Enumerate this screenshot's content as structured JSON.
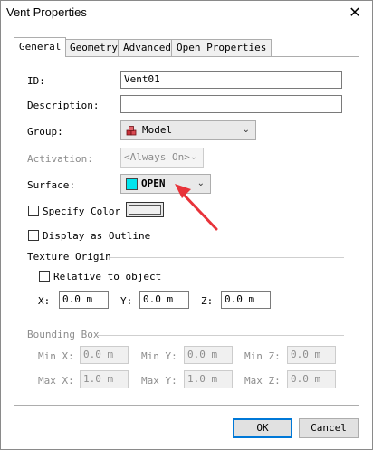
{
  "window": {
    "title": "Vent Properties",
    "close_glyph": "✕"
  },
  "tabs": [
    {
      "label": "General",
      "active": true
    },
    {
      "label": "Geometry",
      "active": false
    },
    {
      "label": "Advanced",
      "active": false
    },
    {
      "label": "Open Properties",
      "active": false
    }
  ],
  "form": {
    "id_label": "ID:",
    "id_value": "Vent01",
    "description_label": "Description:",
    "description_value": "",
    "group_label": "Group:",
    "group_value": "Model",
    "group_icon": "model-cubes-icon",
    "activation_label": "Activation:",
    "activation_value": "<Always On>",
    "surface_label": "Surface:",
    "surface_value": "OPEN",
    "surface_color": "#00e5ee",
    "specify_color_label": "Specify Color",
    "specify_color_checked": false,
    "display_outline_label": "Display as Outline",
    "display_outline_checked": false
  },
  "texture_origin": {
    "title": "Texture Origin",
    "relative_label": "Relative to object",
    "relative_checked": false,
    "x_label": "X:",
    "x_value": "0.0 m",
    "y_label": "Y:",
    "y_value": "0.0 m",
    "z_label": "Z:",
    "z_value": "0.0 m"
  },
  "bounding_box": {
    "title": "Bounding Box",
    "min_x_label": "Min X:",
    "min_x_value": "0.0 m",
    "min_y_label": "Min Y:",
    "min_y_value": "0.0 m",
    "min_z_label": "Min Z:",
    "min_z_value": "0.0 m",
    "max_x_label": "Max X:",
    "max_x_value": "1.0 m",
    "max_y_label": "Max Y:",
    "max_y_value": "1.0 m",
    "max_z_label": "Max Z:",
    "max_z_value": "0.0 m"
  },
  "buttons": {
    "ok_label": "OK",
    "cancel_label": "Cancel"
  },
  "annotation": {
    "arrow_color": "#e8333a"
  }
}
